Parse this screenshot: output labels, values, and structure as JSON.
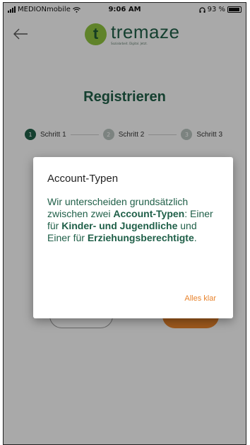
{
  "status_bar": {
    "carrier": "MEDIONmobile",
    "time": "9:06 AM",
    "battery": "93 %"
  },
  "header": {
    "logo_letter": "t",
    "logo_word": "tremaze",
    "logo_tagline": "Sozialarbeit. Digital. Jetzt."
  },
  "page": {
    "title": "Registrieren",
    "steps": [
      {
        "number": "1",
        "label": "Schritt 1"
      },
      {
        "number": "2",
        "label": "Schritt 2"
      },
      {
        "number": "3",
        "label": "Schritt 3"
      }
    ]
  },
  "dialog": {
    "title": "Account-Typen",
    "body": {
      "p1": "Wir unterscheiden grundsätzlich zwischen zwei ",
      "b1": "Account-Typen",
      "p2": ": Einer für ",
      "b2": "Kinder- und Jugendliche",
      "p3": " und Einer für ",
      "b3": "Erziehungsberechtigte",
      "p4": "."
    },
    "action_label": "Alles klar"
  },
  "colors": {
    "brand_green": "#1f5f48",
    "logo_green": "#8ec23f",
    "accent_orange": "#e8832c"
  }
}
